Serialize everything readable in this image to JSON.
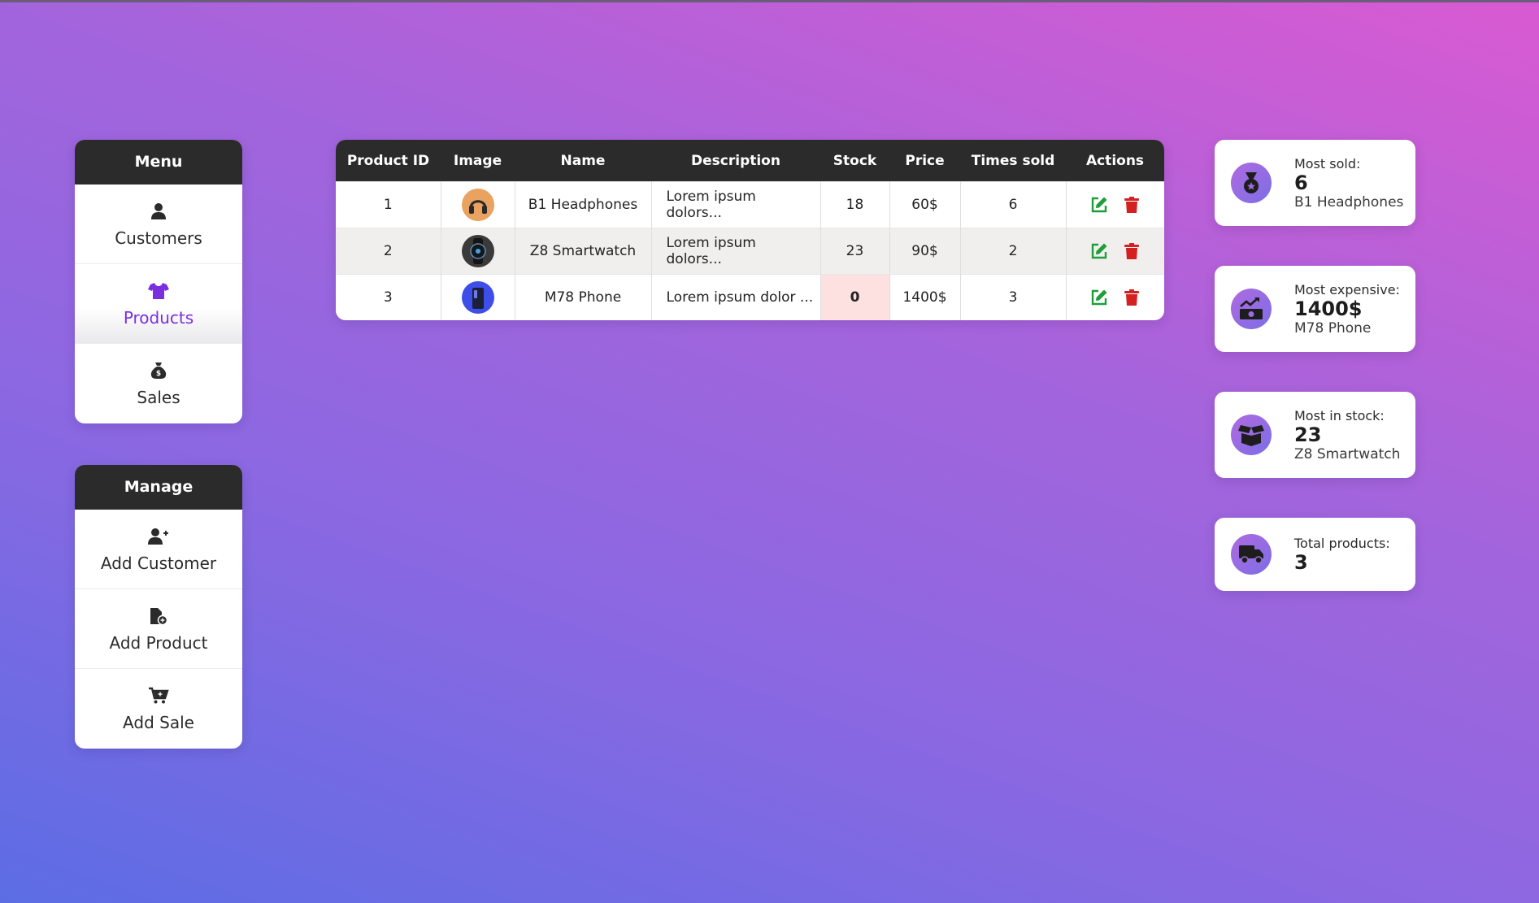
{
  "menu": {
    "title": "Menu",
    "items": [
      {
        "label": "Customers",
        "icon": "user-icon"
      },
      {
        "label": "Products",
        "icon": "shirt-icon"
      },
      {
        "label": "Sales",
        "icon": "money-bag-icon"
      }
    ],
    "active_color": "#7a2ee0"
  },
  "manage": {
    "title": "Manage",
    "items": [
      {
        "label": "Add Customer",
        "icon": "user-plus-icon"
      },
      {
        "label": "Add Product",
        "icon": "file-plus-icon"
      },
      {
        "label": "Add Sale",
        "icon": "cart-plus-icon"
      }
    ]
  },
  "table": {
    "headers": [
      "Product ID",
      "Image",
      "Name",
      "Description",
      "Stock",
      "Price",
      "Times sold",
      "Actions"
    ],
    "rows": [
      {
        "id": "1",
        "image": "headphones-thumbnail",
        "name": "B1 Headphones",
        "description": "Lorem ipsum dolors...",
        "stock": "18",
        "price": "60$",
        "times_sold": "6"
      },
      {
        "id": "2",
        "image": "smartwatch-thumbnail",
        "name": "Z8 Smartwatch",
        "description": "Lorem ipsum dolors...",
        "stock": "23",
        "price": "90$",
        "times_sold": "2"
      },
      {
        "id": "3",
        "image": "phone-thumbnail",
        "name": "M78 Phone",
        "description": "Lorem ipsum dolor ...",
        "stock": "0",
        "price": "1400$",
        "times_sold": "3"
      }
    ],
    "edit_color": "#1e9e3a",
    "delete_color": "#d42020",
    "out_of_stock_bg": "#fde1e1"
  },
  "stats": [
    {
      "label": "Most sold:",
      "value": "6",
      "sub": "B1 Headphones",
      "icon": "medal-icon"
    },
    {
      "label": "Most expensive:",
      "value": "1400$",
      "sub": "M78 Phone",
      "icon": "money-trend-icon"
    },
    {
      "label": "Most in stock:",
      "value": "23",
      "sub": "Z8 Smartwatch",
      "icon": "open-box-icon"
    },
    {
      "label": "Total products:",
      "value": "3",
      "icon": "truck-icon"
    }
  ]
}
